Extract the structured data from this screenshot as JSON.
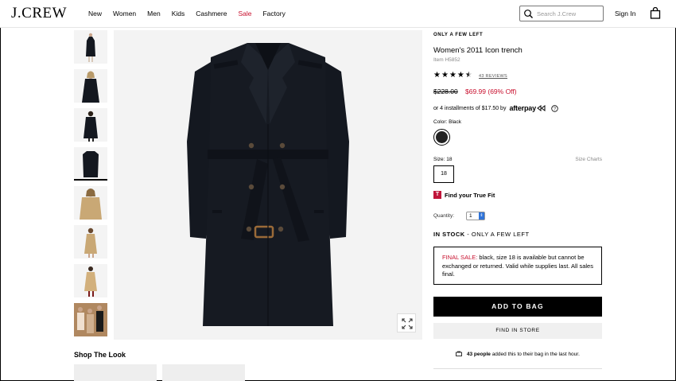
{
  "header": {
    "logo": "J.CREW",
    "nav": [
      "New",
      "Women",
      "Men",
      "Kids",
      "Cashmere",
      "Sale",
      "Factory"
    ],
    "search_placeholder": "Search J.Crew",
    "sign_in": "Sign In"
  },
  "product": {
    "availability_flag": "ONLY A FEW LEFT",
    "title": "Women's 2011 Icon trench",
    "item_number": "Item H5852",
    "rating": 4.5,
    "reviews_label": "43 REVIEWS",
    "original_price": "$228.00",
    "sale_price": "$69.99 (69% Off)",
    "installments_text": "or 4 installments of $17.50 by",
    "afterpay_label": "afterpay",
    "color_label": "Color:",
    "color_value": "Black",
    "size_label": "Size:",
    "size_value": "18",
    "size_charts": "Size Charts",
    "size_option": "18",
    "truefit_badge": "T",
    "truefit_label": "Find your True Fit",
    "quantity_label": "Quantity:",
    "quantity_value": "1",
    "stock_status": "IN STOCK",
    "stock_detail": "- ONLY A FEW LEFT",
    "final_sale_label": "FINAL SALE:",
    "final_sale_text": "black, size 18 is available but cannot be exchanged or returned. Valid while supplies last. All sales final.",
    "add_to_bag": "ADD TO BAG",
    "find_in_store": "FIND IN STORE",
    "people_count": "43 people",
    "people_text": "added this to their bag in the last hour."
  },
  "shop_the_look": "Shop The Look",
  "colors": {
    "sale_red": "#c8102e",
    "coat": "#141820",
    "camel": "#c9a875"
  }
}
